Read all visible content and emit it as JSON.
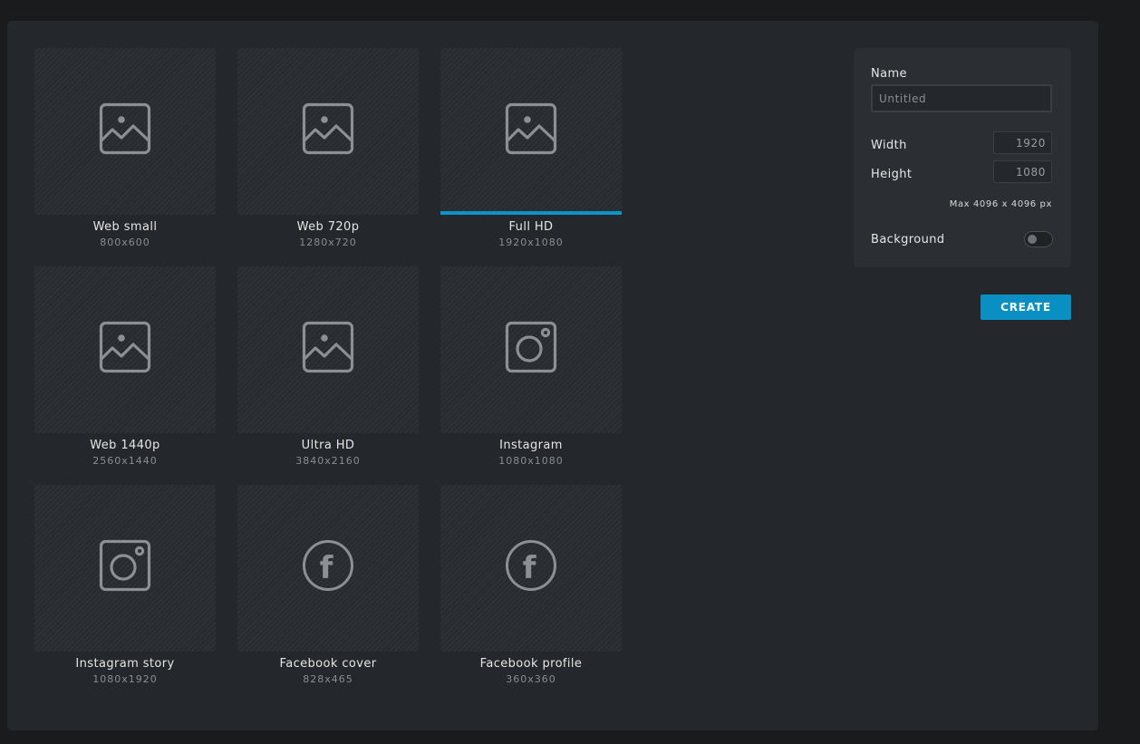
{
  "presets": [
    {
      "name": "Web small",
      "size": "800x600",
      "icon": "image-icon",
      "selected": false
    },
    {
      "name": "Web 720p",
      "size": "1280x720",
      "icon": "image-icon",
      "selected": false
    },
    {
      "name": "Full HD",
      "size": "1920x1080",
      "icon": "image-icon",
      "selected": true
    },
    {
      "name": "Web 1440p",
      "size": "2560x1440",
      "icon": "image-icon",
      "selected": false
    },
    {
      "name": "Ultra HD",
      "size": "3840x2160",
      "icon": "image-icon",
      "selected": false
    },
    {
      "name": "Instagram",
      "size": "1080x1080",
      "icon": "instagram-icon",
      "selected": false
    },
    {
      "name": "Instagram story",
      "size": "1080x1920",
      "icon": "instagram-icon",
      "selected": false
    },
    {
      "name": "Facebook cover",
      "size": "828x465",
      "icon": "facebook-icon",
      "selected": false
    },
    {
      "name": "Facebook profile",
      "size": "360x360",
      "icon": "facebook-icon",
      "selected": false
    }
  ],
  "form": {
    "name_label": "Name",
    "name_placeholder": "Untitled",
    "name_value": "",
    "width_label": "Width",
    "width_value": "1920",
    "height_label": "Height",
    "height_value": "1080",
    "max_note": "Max 4096 x 4096 px",
    "background_label": "Background",
    "background_enabled": false
  },
  "create_label": "CREATE",
  "colors": {
    "accent": "#0a95c9",
    "dialog_bg": "#24272b",
    "panel_bg": "#2b2e33",
    "icon_stroke": "#8d8f92"
  }
}
